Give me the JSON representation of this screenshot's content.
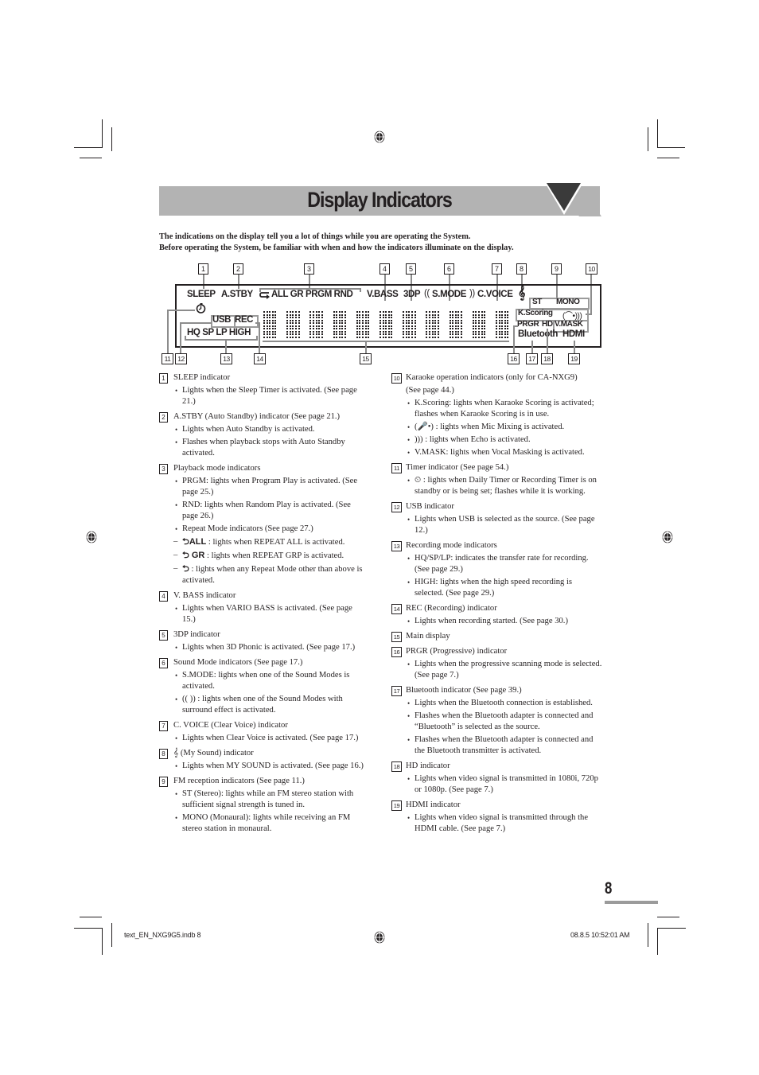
{
  "page": {
    "title": "Display Indicators",
    "intro": [
      "The indications on the display tell you a lot of things while you are operating the System.",
      "Before operating the System, be familiar with when and how the indicators illuminate on the display."
    ],
    "page_number": "8",
    "slug_left": "text_EN_NXG9G5.indb   8",
    "slug_right": "08.8.5   10:52:01 AM"
  },
  "diagram": {
    "callouts_top": [
      "1",
      "2",
      "3",
      "4",
      "5",
      "6",
      "7",
      "8",
      "9",
      "10"
    ],
    "callouts_bottom": [
      "11",
      "12",
      "13",
      "14",
      "15",
      "16",
      "17",
      "18",
      "19"
    ],
    "labels": {
      "sleep": "SLEEP",
      "astby": "A.STBY",
      "repeat": "ALL GR PRGM RND",
      "vbass": "V.BASS",
      "threedp": "3DP",
      "smode": "S.MODE",
      "cvoice": "C.VOICE",
      "mysound_icon": "𝄞",
      "st": "ST",
      "mono": "MONO",
      "kscoring": "K.Scoring",
      "usb": "USB",
      "rec": "REC",
      "rec_modes": "HQ SP LP HIGH",
      "prgr": "PRGR",
      "hd": "HD",
      "vmask": "V.MASK",
      "bluetooth": "Bluetooth",
      "hdmi": "HDMI"
    },
    "matrix_chars": 11
  },
  "items": [
    {
      "n": "1",
      "head": "SLEEP indicator",
      "bullets": [
        "Lights when the Sleep Timer is activated. (See page 21.)"
      ]
    },
    {
      "n": "2",
      "head": "A.STBY (Auto Standby) indicator (See page 21.)",
      "bullets": [
        "Lights when Auto Standby is activated.",
        "Flashes when playback stops with Auto Standby activated."
      ]
    },
    {
      "n": "3",
      "head": "Playback mode indicators",
      "bullets": [
        "PRGM: lights when Program Play is activated. (See page 25.)",
        "RND: lights when Random Play is activated. (See page 26.)",
        "Repeat Mode indicators (See page 27.)"
      ],
      "dashes": [
        {
          "icon": "ALL",
          "text": ": lights when REPEAT ALL is activated."
        },
        {
          "icon": " GR",
          "text": ": lights when REPEAT GRP is activated."
        },
        {
          "icon": "",
          "text": ": lights when any Repeat Mode other than above is activated."
        }
      ]
    },
    {
      "n": "4",
      "head": "V. BASS indicator",
      "bullets": [
        "Lights when VARIO BASS is activated. (See page 15.)"
      ]
    },
    {
      "n": "5",
      "head": "3DP indicator",
      "bullets": [
        "Lights when 3D Phonic is activated. (See page 17.)"
      ]
    },
    {
      "n": "6",
      "head": "Sound Mode indicators (See page 17.)",
      "bullets": [
        "S.MODE: lights when one of the Sound Modes is activated.",
        "((   )) : lights when one of the Sound Modes with surround effect is activated."
      ]
    },
    {
      "n": "7",
      "head": "C. VOICE (Clear Voice) indicator",
      "bullets": [
        "Lights when Clear Voice is activated. (See page 17.)"
      ]
    },
    {
      "n": "8",
      "head": "𝄞 (My Sound) indicator",
      "bullets": [
        "Lights when MY SOUND is activated. (See page 16.)"
      ]
    },
    {
      "n": "9",
      "head": "FM reception indicators (See page 11.)",
      "bullets": [
        "ST (Stereo): lights while an FM stereo station with sufficient signal strength is tuned in.",
        "MONO (Monaural): lights while receiving an FM stereo station in monaural."
      ]
    },
    {
      "n": "10",
      "head": "Karaoke operation indicators (only for CA-NXG9)",
      "subhead": "(See page 44.)",
      "bullets": [
        "K.Scoring: lights when Karaoke Scoring is activated; flashes when Karaoke Scoring is in use.",
        "(🎤•) : lights when Mic Mixing is activated.",
        ")))  : lights when Echo is activated.",
        "V.MASK: lights when Vocal Masking is activated."
      ]
    },
    {
      "n": "11",
      "head": "Timer indicator (See page 54.)",
      "bullets": [
        "⏲ : lights when Daily Timer or Recording Timer is on standby or is being set; flashes while it is working."
      ]
    },
    {
      "n": "12",
      "head": "USB indicator",
      "bullets": [
        "Lights when USB is selected as the source. (See page 12.)"
      ]
    },
    {
      "n": "13",
      "head": "Recording mode indicators",
      "bullets": [
        "HQ/SP/LP: indicates the transfer rate for recording. (See page 29.)",
        "HIGH: lights when the high speed recording is selected. (See page 29.)"
      ]
    },
    {
      "n": "14",
      "head": "REC (Recording) indicator",
      "bullets": [
        "Lights when recording started. (See page 30.)"
      ]
    },
    {
      "n": "15",
      "head": "Main display",
      "bullets": []
    },
    {
      "n": "16",
      "head": "PRGR (Progressive) indicator",
      "bullets": [
        "Lights when the progressive scanning mode is selected. (See page 7.)"
      ]
    },
    {
      "n": "17",
      "head": "Bluetooth indicator (See page 39.)",
      "bullets": [
        "Lights when the Bluetooth connection is established.",
        "Flashes when the Bluetooth adapter is connected and “Bluetooth” is selected as the source.",
        "Flashes when the Bluetooth adapter is connected and the Bluetooth transmitter is activated."
      ]
    },
    {
      "n": "18",
      "head": "HD indicator",
      "bullets": [
        "Lights when video signal is transmitted in 1080i, 720p or 1080p. (See page 7.)"
      ]
    },
    {
      "n": "19",
      "head": "HDMI indicator",
      "bullets": [
        "Lights when video signal is transmitted through the HDMI cable. (See page 7.)"
      ]
    }
  ]
}
